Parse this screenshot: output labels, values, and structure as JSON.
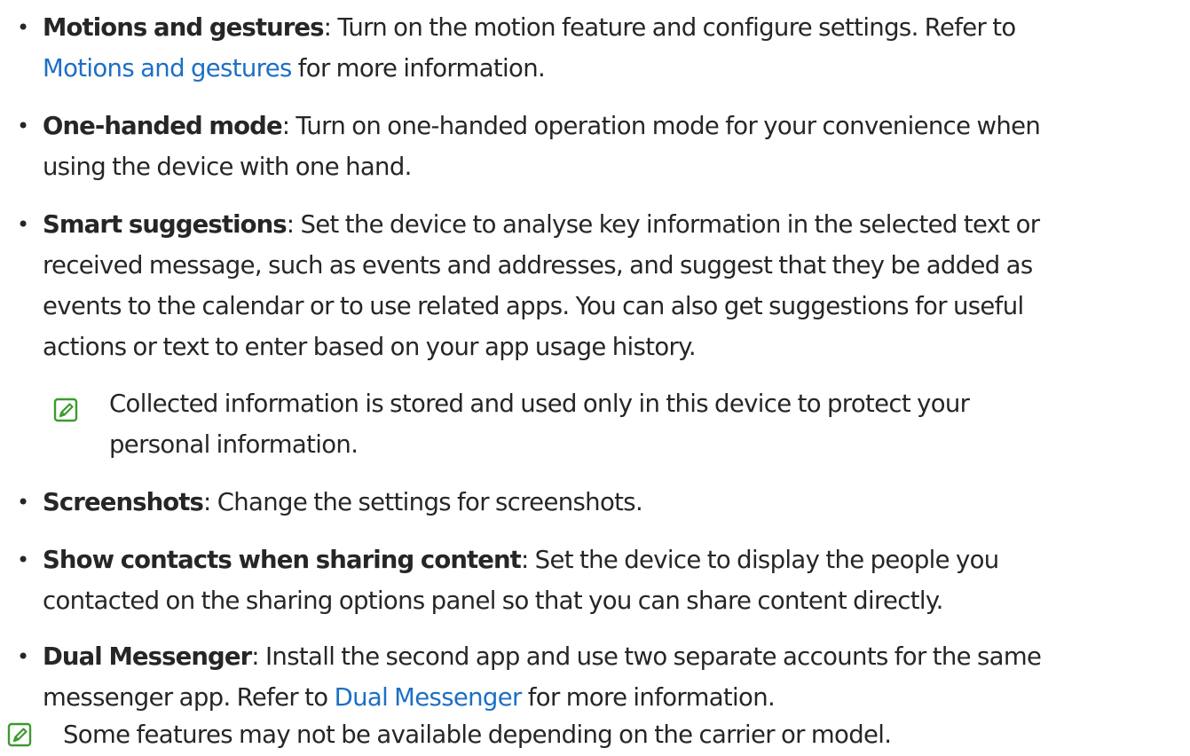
{
  "items": [
    {
      "bullet": "•",
      "term": "Motions and gestures",
      "line1": ": Turn on the motion feature and configure settings. Refer to",
      "link": "Motions and gestures",
      "line2_rest": " for more information."
    },
    {
      "bullet": "•",
      "term": "One-handed mode",
      "line1": ": Turn on one-handed operation mode for your convenience when",
      "line2": "using the device with one hand."
    },
    {
      "bullet": "•",
      "term": "Smart suggestions",
      "line1": ": Set the device to analyse key information in the selected text or",
      "line2": "received message, such as events and addresses, and suggest that they be added as",
      "line3": "events to the calendar or to use related apps. You can also get suggestions for useful",
      "line4": "actions or text to enter based on your app usage history."
    },
    {
      "bullet": "•",
      "term": "Screenshots",
      "line1": ": Change the settings for screenshots."
    },
    {
      "bullet": "•",
      "term": "Show contacts when sharing content",
      "line1": ": Set the device to display the people you",
      "line2": "contacted on the sharing options panel so that you can share content directly."
    },
    {
      "bullet": "•",
      "term": "Dual Messenger",
      "line1": ": Install the second app and use two separate accounts for the same",
      "line2_pre": "messenger app. Refer to ",
      "link": "Dual Messenger",
      "line2_rest": " for more information."
    }
  ],
  "smart_note": {
    "line1": "Collected information is stored and used only in this device to protect your",
    "line2": "personal information."
  },
  "bottom_note": {
    "text": "Some features may not be available depending on the carrier or model."
  },
  "colors": {
    "text": "#262626",
    "link": "#1d6fc4",
    "note_icon": "#3d9a2e"
  }
}
